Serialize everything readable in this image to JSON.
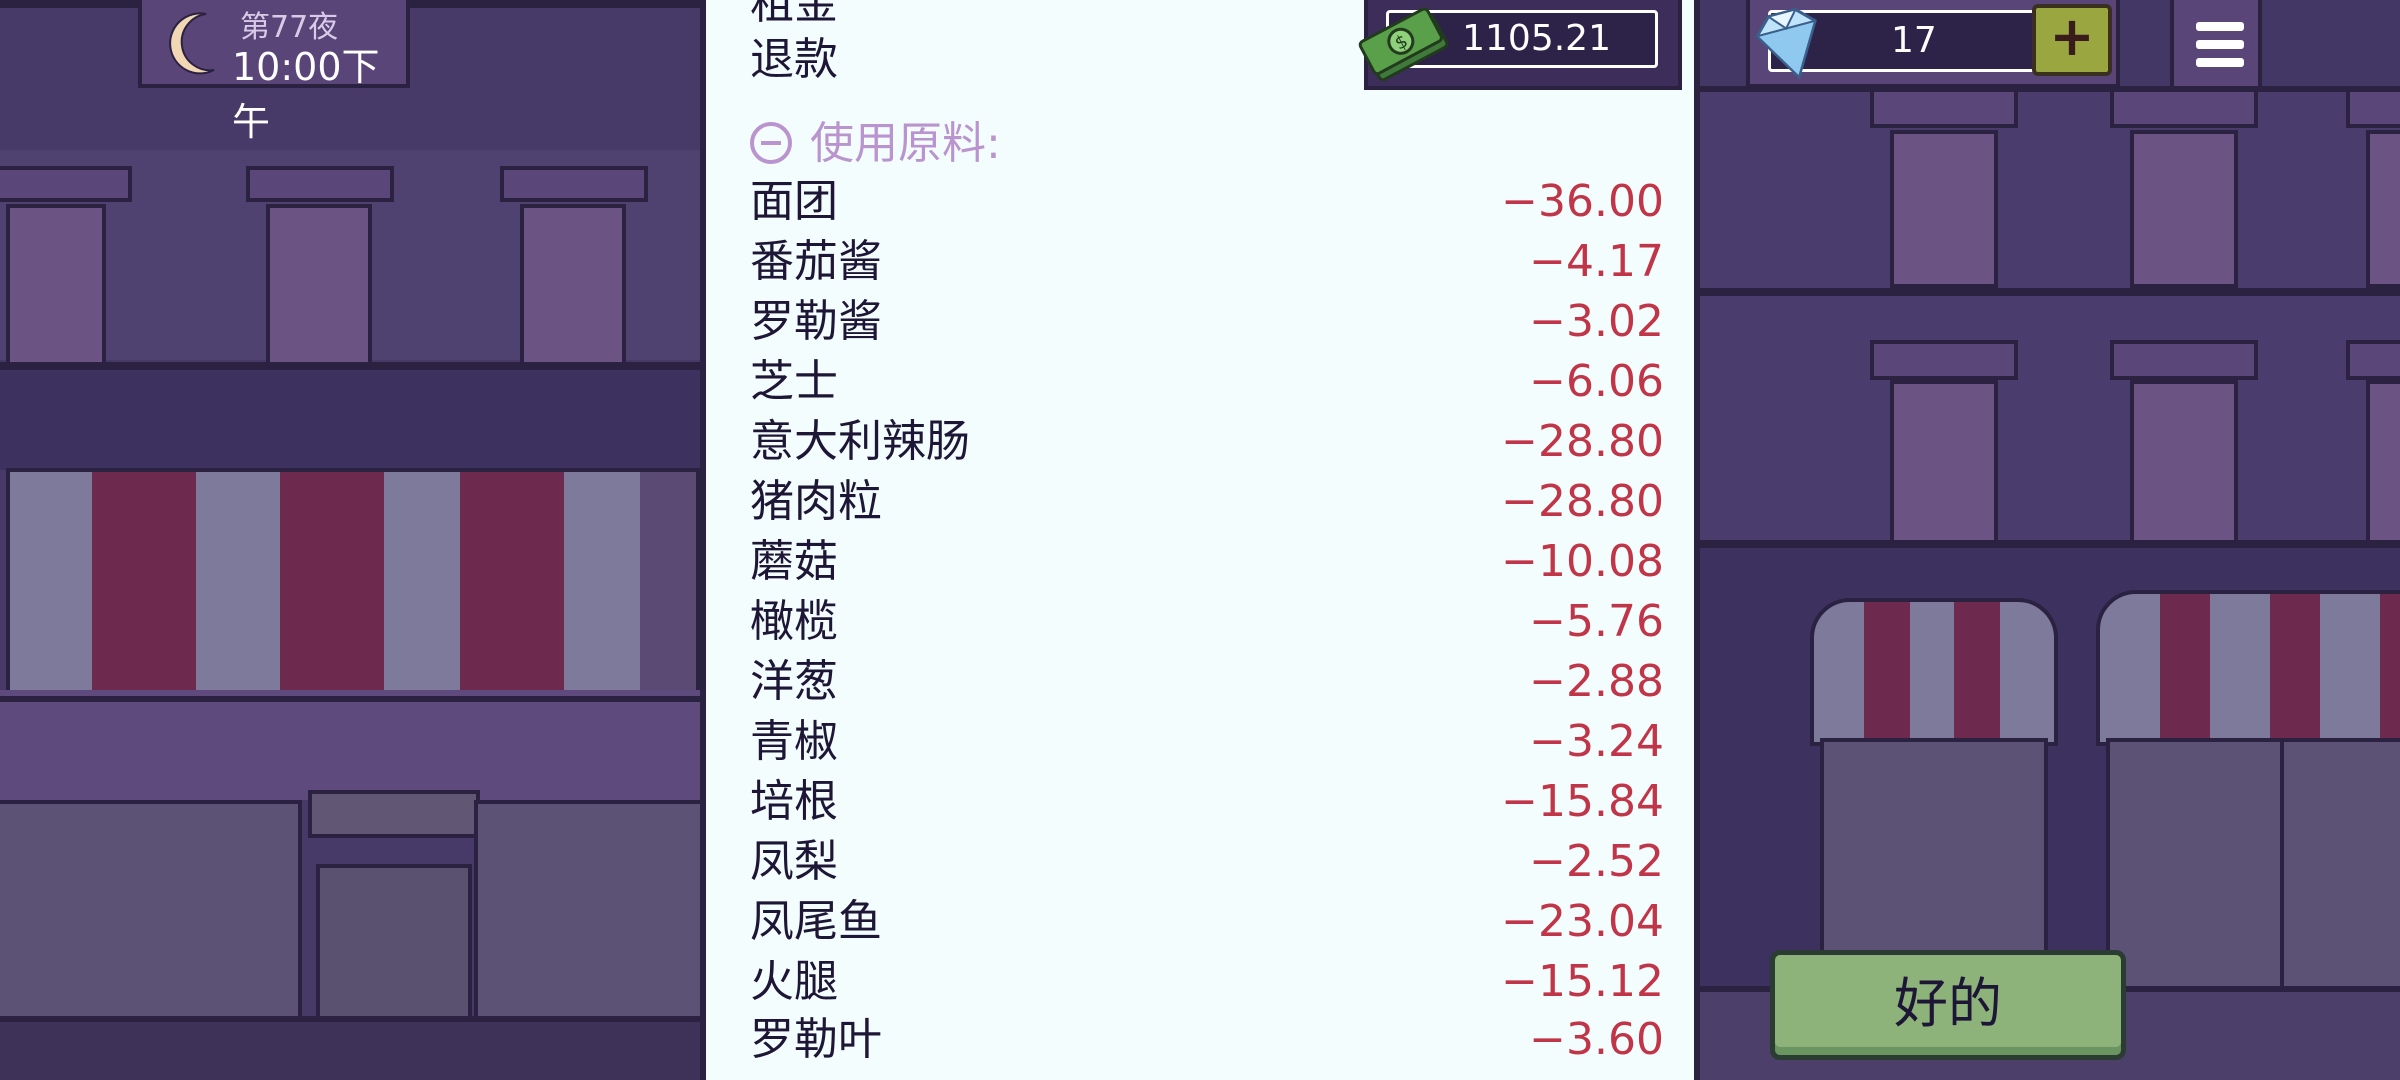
{
  "hud": {
    "night_label": "第77夜",
    "time_label": "10:00下午",
    "money": "1105.21",
    "gems": "17",
    "plus_label": "+"
  },
  "receipt": {
    "partial_top_label": "租金",
    "refund_label": "退款",
    "section_title": "使用原料:",
    "ingredients": [
      {
        "name": "面团",
        "amount": "−36.00"
      },
      {
        "name": "番茄酱",
        "amount": "−4.17"
      },
      {
        "name": "罗勒酱",
        "amount": "−3.02"
      },
      {
        "name": "芝士",
        "amount": "−6.06"
      },
      {
        "name": "意大利辣肠",
        "amount": "−28.80"
      },
      {
        "name": "猪肉粒",
        "amount": "−28.80"
      },
      {
        "name": "蘑菇",
        "amount": "−10.08"
      },
      {
        "name": "橄榄",
        "amount": "−5.76"
      },
      {
        "name": "洋葱",
        "amount": "−2.88"
      },
      {
        "name": "青椒",
        "amount": "−3.24"
      },
      {
        "name": "培根",
        "amount": "−15.84"
      },
      {
        "name": "凤梨",
        "amount": "−2.52"
      },
      {
        "name": "凤尾鱼",
        "amount": "−23.04"
      },
      {
        "name": "火腿",
        "amount": "−15.12"
      },
      {
        "name": "罗勒叶",
        "amount": "−3.60"
      }
    ]
  },
  "ok_button_label": "好的",
  "colors": {
    "receipt_bg": "#f3fdfd",
    "amount_red": "#c03548",
    "section_purple": "#b994cf",
    "ok_green": "#8db37a",
    "scene_purple": "#473a68"
  }
}
